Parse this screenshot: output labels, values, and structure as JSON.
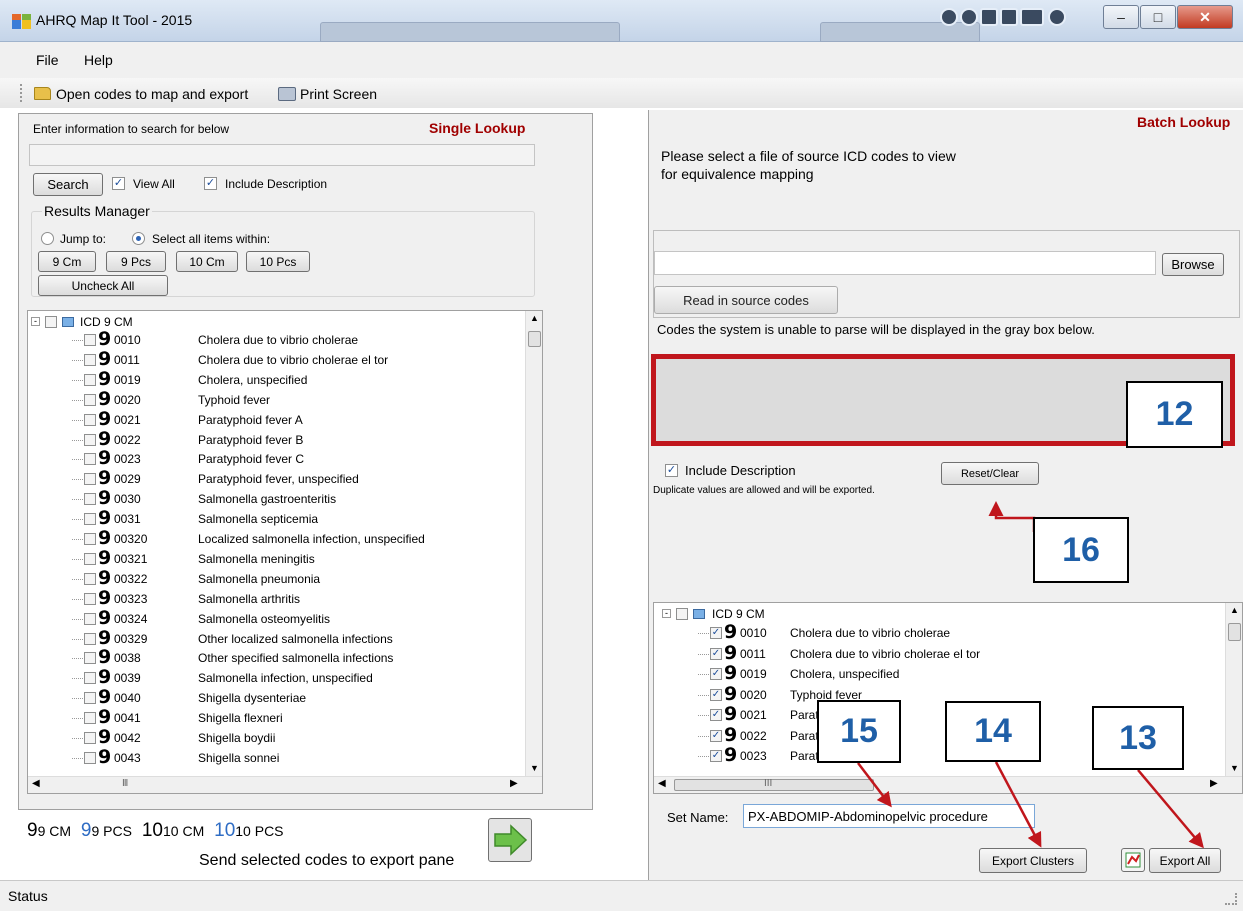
{
  "window": {
    "title": "AHRQ Map It Tool - 2015"
  },
  "menu": {
    "file": "File",
    "help": "Help"
  },
  "toolbar": {
    "open_label": "Open codes to map and export",
    "print_label": "Print Screen"
  },
  "single": {
    "prompt": "Enter information to search for below",
    "header": "Single Lookup",
    "search_value": "",
    "search_button": "Search",
    "view_all": "View All",
    "include_description": "Include Description",
    "results_manager": "Results Manager",
    "jump_to": "Jump to:",
    "select_within": "Select all items within:",
    "filter_buttons": [
      "9 Cm",
      "9 Pcs",
      "10 Cm",
      "10 Pcs"
    ],
    "uncheck_all": "Uncheck All",
    "tree_root": "ICD 9 CM",
    "rows": [
      {
        "code": "0010",
        "desc": "Cholera due to vibrio cholerae"
      },
      {
        "code": "0011",
        "desc": "Cholera due to vibrio cholerae el tor"
      },
      {
        "code": "0019",
        "desc": "Cholera, unspecified"
      },
      {
        "code": "0020",
        "desc": "Typhoid fever"
      },
      {
        "code": "0021",
        "desc": "Paratyphoid fever A"
      },
      {
        "code": "0022",
        "desc": "Paratyphoid fever B"
      },
      {
        "code": "0023",
        "desc": "Paratyphoid fever C"
      },
      {
        "code": "0029",
        "desc": "Paratyphoid fever, unspecified"
      },
      {
        "code": "0030",
        "desc": "Salmonella gastroenteritis"
      },
      {
        "code": "0031",
        "desc": "Salmonella septicemia"
      },
      {
        "code": "00320",
        "desc": "Localized salmonella infection, unspecified"
      },
      {
        "code": "00321",
        "desc": "Salmonella meningitis"
      },
      {
        "code": "00322",
        "desc": "Salmonella pneumonia"
      },
      {
        "code": "00323",
        "desc": "Salmonella arthritis"
      },
      {
        "code": "00324",
        "desc": "Salmonella osteomyelitis"
      },
      {
        "code": "00329",
        "desc": "Other localized salmonella infections"
      },
      {
        "code": "0038",
        "desc": "Other specified salmonella infections"
      },
      {
        "code": "0039",
        "desc": "Salmonella infection, unspecified"
      },
      {
        "code": "0040",
        "desc": "Shigella dysenteriae"
      },
      {
        "code": "0041",
        "desc": "Shigella flexneri"
      },
      {
        "code": "0042",
        "desc": "Shigella boydii"
      },
      {
        "code": "0043",
        "desc": "Shigella sonnei"
      }
    ],
    "legend": [
      {
        "glyph": "9",
        "text": "9 CM",
        "color": "#000000"
      },
      {
        "glyph": "9",
        "text": "9 PCS",
        "color": "#2e6cc4"
      },
      {
        "glyph": "10",
        "text": "10 CM",
        "color": "#000000"
      },
      {
        "glyph": "10",
        "text": "10 PCS",
        "color": "#2e6cc4"
      }
    ],
    "send_label": "Send selected codes to export pane",
    "hscroll_mark": "III"
  },
  "batch": {
    "header": "Batch Lookup",
    "instructions_line1": "Please select a file of source ICD codes to view",
    "instructions_line2": "for equivalence mapping",
    "file_value": "",
    "browse_button": "Browse",
    "read_button": "Read in source codes",
    "parse_note": "Codes the system is unable to parse will be displayed in the gray box below.",
    "include_description": "Include Description",
    "duplicate_note": "Duplicate values are allowed and will be exported.",
    "reset_button": "Reset/Clear",
    "tree_root": "ICD 9 CM",
    "rows": [
      {
        "code": "0010",
        "desc": "Cholera due to vibrio cholerae"
      },
      {
        "code": "0011",
        "desc": "Cholera due to vibrio cholerae el tor"
      },
      {
        "code": "0019",
        "desc": "Cholera, unspecified"
      },
      {
        "code": "0020",
        "desc": "Typhoid fever"
      },
      {
        "code": "0021",
        "desc": "Paratyphoid fever A"
      },
      {
        "code": "0022",
        "desc": "Paratyphoid fever B"
      },
      {
        "code": "0023",
        "desc": "Paratyphoid fever C"
      }
    ],
    "set_name_label": "Set Name:",
    "set_name_value": "PX-ABDOMIP-Abdominopelvic procedure",
    "export_clusters": "Export Clusters",
    "export_all": "Export All",
    "hscroll_mark": "III"
  },
  "callouts": {
    "c12": "12",
    "c13": "13",
    "c14": "14",
    "c15": "15",
    "c16": "16"
  },
  "status": {
    "text": "Status"
  },
  "colors": {
    "highlight": "#c0161c",
    "callout_text": "#1f5fa7",
    "header_red": "#a00000"
  }
}
